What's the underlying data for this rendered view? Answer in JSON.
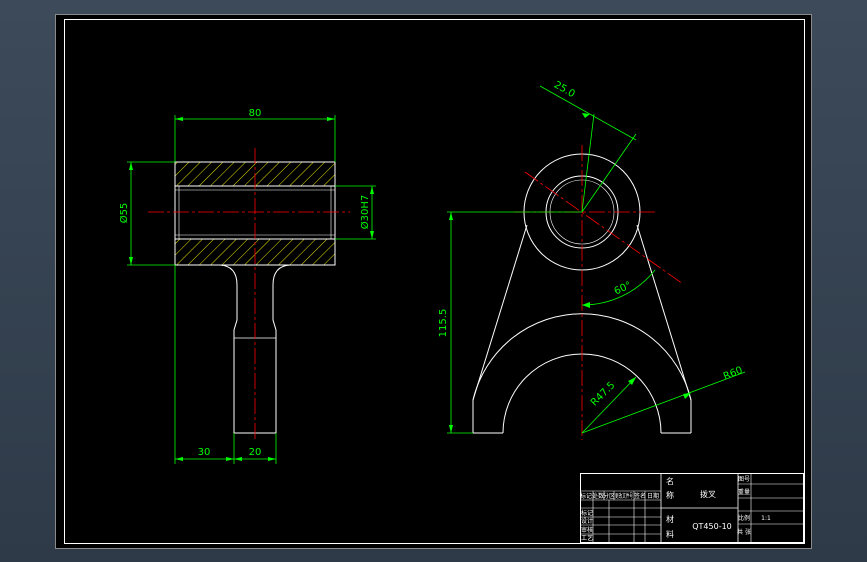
{
  "colors": {
    "background": "#2e3a48",
    "paper": "#000000",
    "outline": "#ffffff",
    "dimension": "#00ff00",
    "centerline": "#ff0000",
    "hatch": "#ffff00"
  },
  "front_view": {
    "dim_width": "80",
    "dim_outer_diameter": "Ø55",
    "dim_bore": "Ø30H7",
    "dim_left": "30",
    "dim_shaft": "20"
  },
  "side_view": {
    "dim_offset": "25.0",
    "dim_angle": "60°",
    "dim_height": "115.5",
    "dim_inner_radius": "R47.5",
    "dim_outer_radius": "R60"
  },
  "title_block": {
    "name_label_1": "名",
    "name_label_2": "称",
    "part_name": "拨叉",
    "material_label_1": "材",
    "material_label_2": "料",
    "material": "QT450-10",
    "scale_value": "1:1",
    "row_labels": [
      "标记",
      "设计",
      "审核",
      "工艺"
    ],
    "header_cells": [
      "标记",
      "处数",
      "分区",
      "更改文件号",
      "签名",
      "日期"
    ],
    "right_labels": [
      "图号",
      "重量",
      "比例",
      "共 张"
    ]
  }
}
